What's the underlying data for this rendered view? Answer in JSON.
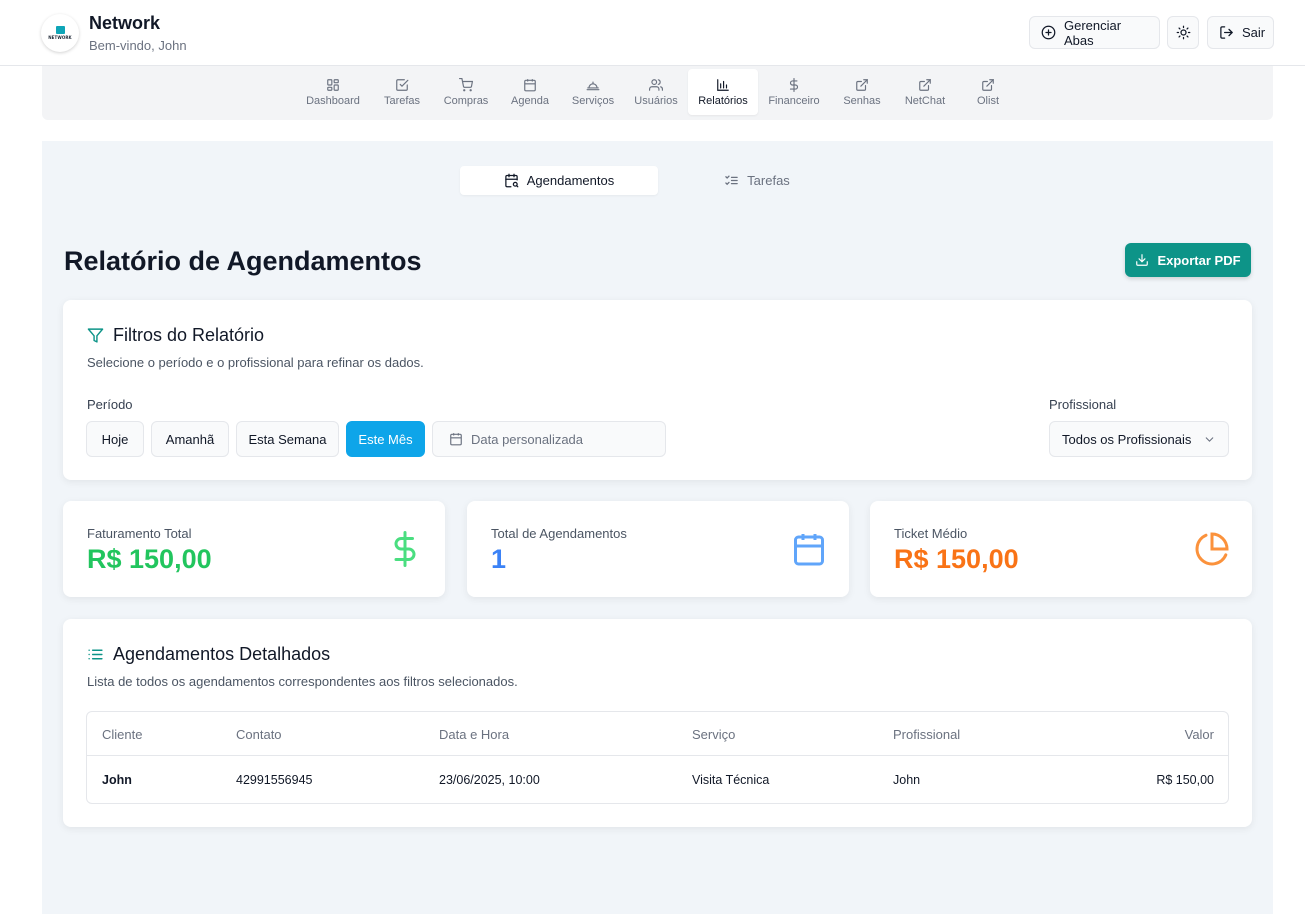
{
  "header": {
    "logo_text": "NETWORK",
    "title": "Network",
    "subtitle": "Bem-vindo, John",
    "manage_tabs_label": "Gerenciar Abas",
    "logout_label": "Sair"
  },
  "nav": {
    "items": [
      {
        "label": "Dashboard",
        "icon": "dashboard-icon"
      },
      {
        "label": "Tarefas",
        "icon": "checkbox-icon"
      },
      {
        "label": "Compras",
        "icon": "cart-icon"
      },
      {
        "label": "Agenda",
        "icon": "calendar-icon"
      },
      {
        "label": "Serviços",
        "icon": "bell-service-icon"
      },
      {
        "label": "Usuários",
        "icon": "users-icon"
      },
      {
        "label": "Relatórios",
        "icon": "bar-chart-icon",
        "active": true
      },
      {
        "label": "Financeiro",
        "icon": "dollar-icon"
      },
      {
        "label": "Senhas",
        "icon": "external-link-icon"
      },
      {
        "label": "NetChat",
        "icon": "external-link-icon"
      },
      {
        "label": "Olist",
        "icon": "external-link-icon"
      }
    ]
  },
  "tabs": {
    "agendamentos": "Agendamentos",
    "tarefas": "Tarefas"
  },
  "page": {
    "title": "Relatório de Agendamentos",
    "export_label": "Exportar PDF"
  },
  "filters": {
    "title": "Filtros do Relatório",
    "description": "Selecione o período e o profissional para refinar os dados.",
    "period_label": "Período",
    "periods": [
      "Hoje",
      "Amanhã",
      "Esta Semana",
      "Este Mês"
    ],
    "active_period": "Este Mês",
    "date_placeholder": "Data personalizada",
    "professional_label": "Profissional",
    "professional_selected": "Todos os Profissionais"
  },
  "stats": {
    "revenue_label": "Faturamento Total",
    "revenue_value": "R$ 150,00",
    "total_label": "Total de Agendamentos",
    "total_value": "1",
    "ticket_label": "Ticket Médio",
    "ticket_value": "R$ 150,00",
    "colors": {
      "revenue": "#22c55e",
      "total": "#3b82f6",
      "ticket": "#f97316"
    }
  },
  "details": {
    "title": "Agendamentos Detalhados",
    "description": "Lista de todos os agendamentos correspondentes aos filtros selecionados.",
    "columns": [
      "Cliente",
      "Contato",
      "Data e Hora",
      "Serviço",
      "Profissional",
      "Valor"
    ],
    "rows": [
      [
        "John",
        "42991556945",
        "23/06/2025, 10:00",
        "Visita Técnica",
        "John",
        "R$ 150,00"
      ]
    ]
  },
  "colors": {
    "accent": "#0d9488",
    "active_period": "#0ea5e9"
  }
}
